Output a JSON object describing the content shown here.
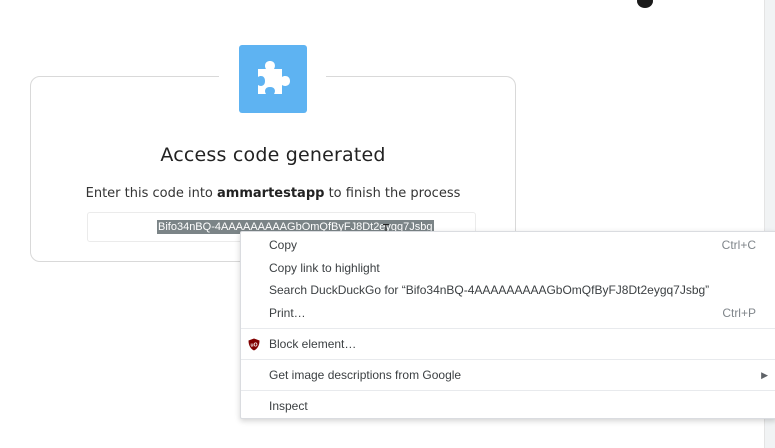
{
  "card": {
    "title": "Access code generated",
    "instruction_prefix": "Enter this code into ",
    "app_name": "ammartestapp",
    "instruction_suffix": " to finish the process",
    "access_code": "Bifo34nBQ-4AAAAAAAAAGbOmQfByFJ8Dt2eygq7Jsbg",
    "logo_icon": "puzzle-piece-icon",
    "accent_color": "#5eb3f2"
  },
  "context_menu": {
    "items": [
      {
        "label": "Copy",
        "shortcut": "Ctrl+C"
      },
      {
        "label": "Copy link to highlight",
        "shortcut": ""
      },
      {
        "label": "Search DuckDuckGo for “Bifo34nBQ-4AAAAAAAAAGbOmQfByFJ8Dt2eygq7Jsbg”",
        "shortcut": ""
      },
      {
        "label": "Print…",
        "shortcut": "Ctrl+P"
      },
      {
        "label": "Block element…",
        "icon": "ublock-origin-icon"
      },
      {
        "label": "Get image descriptions from Google",
        "has_submenu": true
      },
      {
        "label": "Inspect"
      }
    ]
  }
}
